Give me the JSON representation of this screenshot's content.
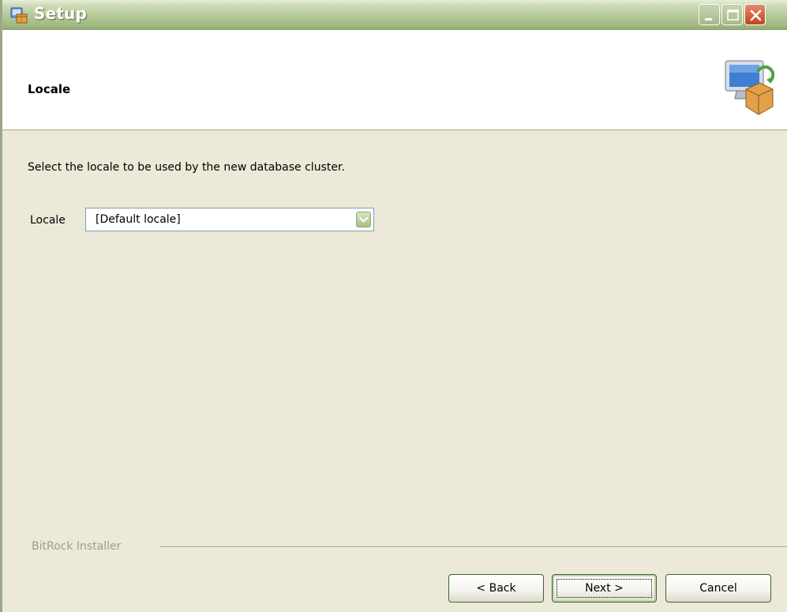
{
  "window": {
    "title": "Setup",
    "app_icon": "setup-box-icon",
    "controls": {
      "minimize": "minimize-icon",
      "maximize": "maximize-icon",
      "close": "close-icon"
    }
  },
  "header": {
    "title": "Locale",
    "icon": "computer-package-icon"
  },
  "content": {
    "instruction": "Select the locale to be used by the new database cluster.",
    "locale": {
      "label": "Locale",
      "selected_value": "[Default locale]"
    }
  },
  "footer": {
    "brand": "BitRock Installer",
    "back_label": "< Back",
    "next_label": "Next >",
    "cancel_label": "Cancel"
  },
  "colors": {
    "titlebar": "#b4c898",
    "window_bg": "#ece9d8",
    "close_button": "#c1441c"
  }
}
